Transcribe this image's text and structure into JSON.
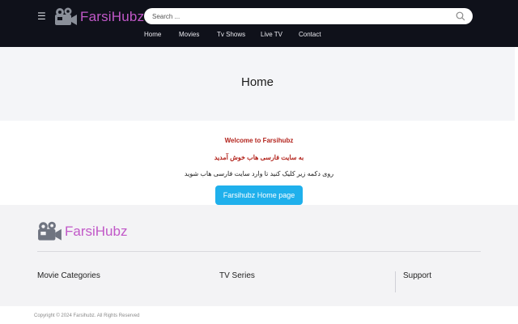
{
  "header": {
    "logo_text": "FarsiHubz",
    "search_placeholder": "Search ...",
    "nav": [
      "Home",
      "Movies",
      "Tv Shows",
      "Live TV",
      "Contact"
    ]
  },
  "hero": {
    "title": "Home"
  },
  "content": {
    "welcome": "Welcome to Farsihubz",
    "welcome_fa": "به سایت فارسی هاب خوش آمدید",
    "instruction": "روی دکمه زیر کلیک کنید تا وارد سایت فارسی هاب شوید",
    "cta_label": "Farsihubz Home page"
  },
  "footer": {
    "logo_text": "FarsiHubz",
    "columns": [
      "Movie Categories",
      "TV Series",
      "Support"
    ],
    "copyright": "Copyright © 2024 Farsihubz. All Rights Reserved"
  },
  "colors": {
    "header_bg": "#0f111a",
    "brand": "#c158c8",
    "accent": "#1fb0ec",
    "welcome": "#b3241d"
  },
  "icons": [
    "menu-icon",
    "camera-icon",
    "search-icon"
  ]
}
